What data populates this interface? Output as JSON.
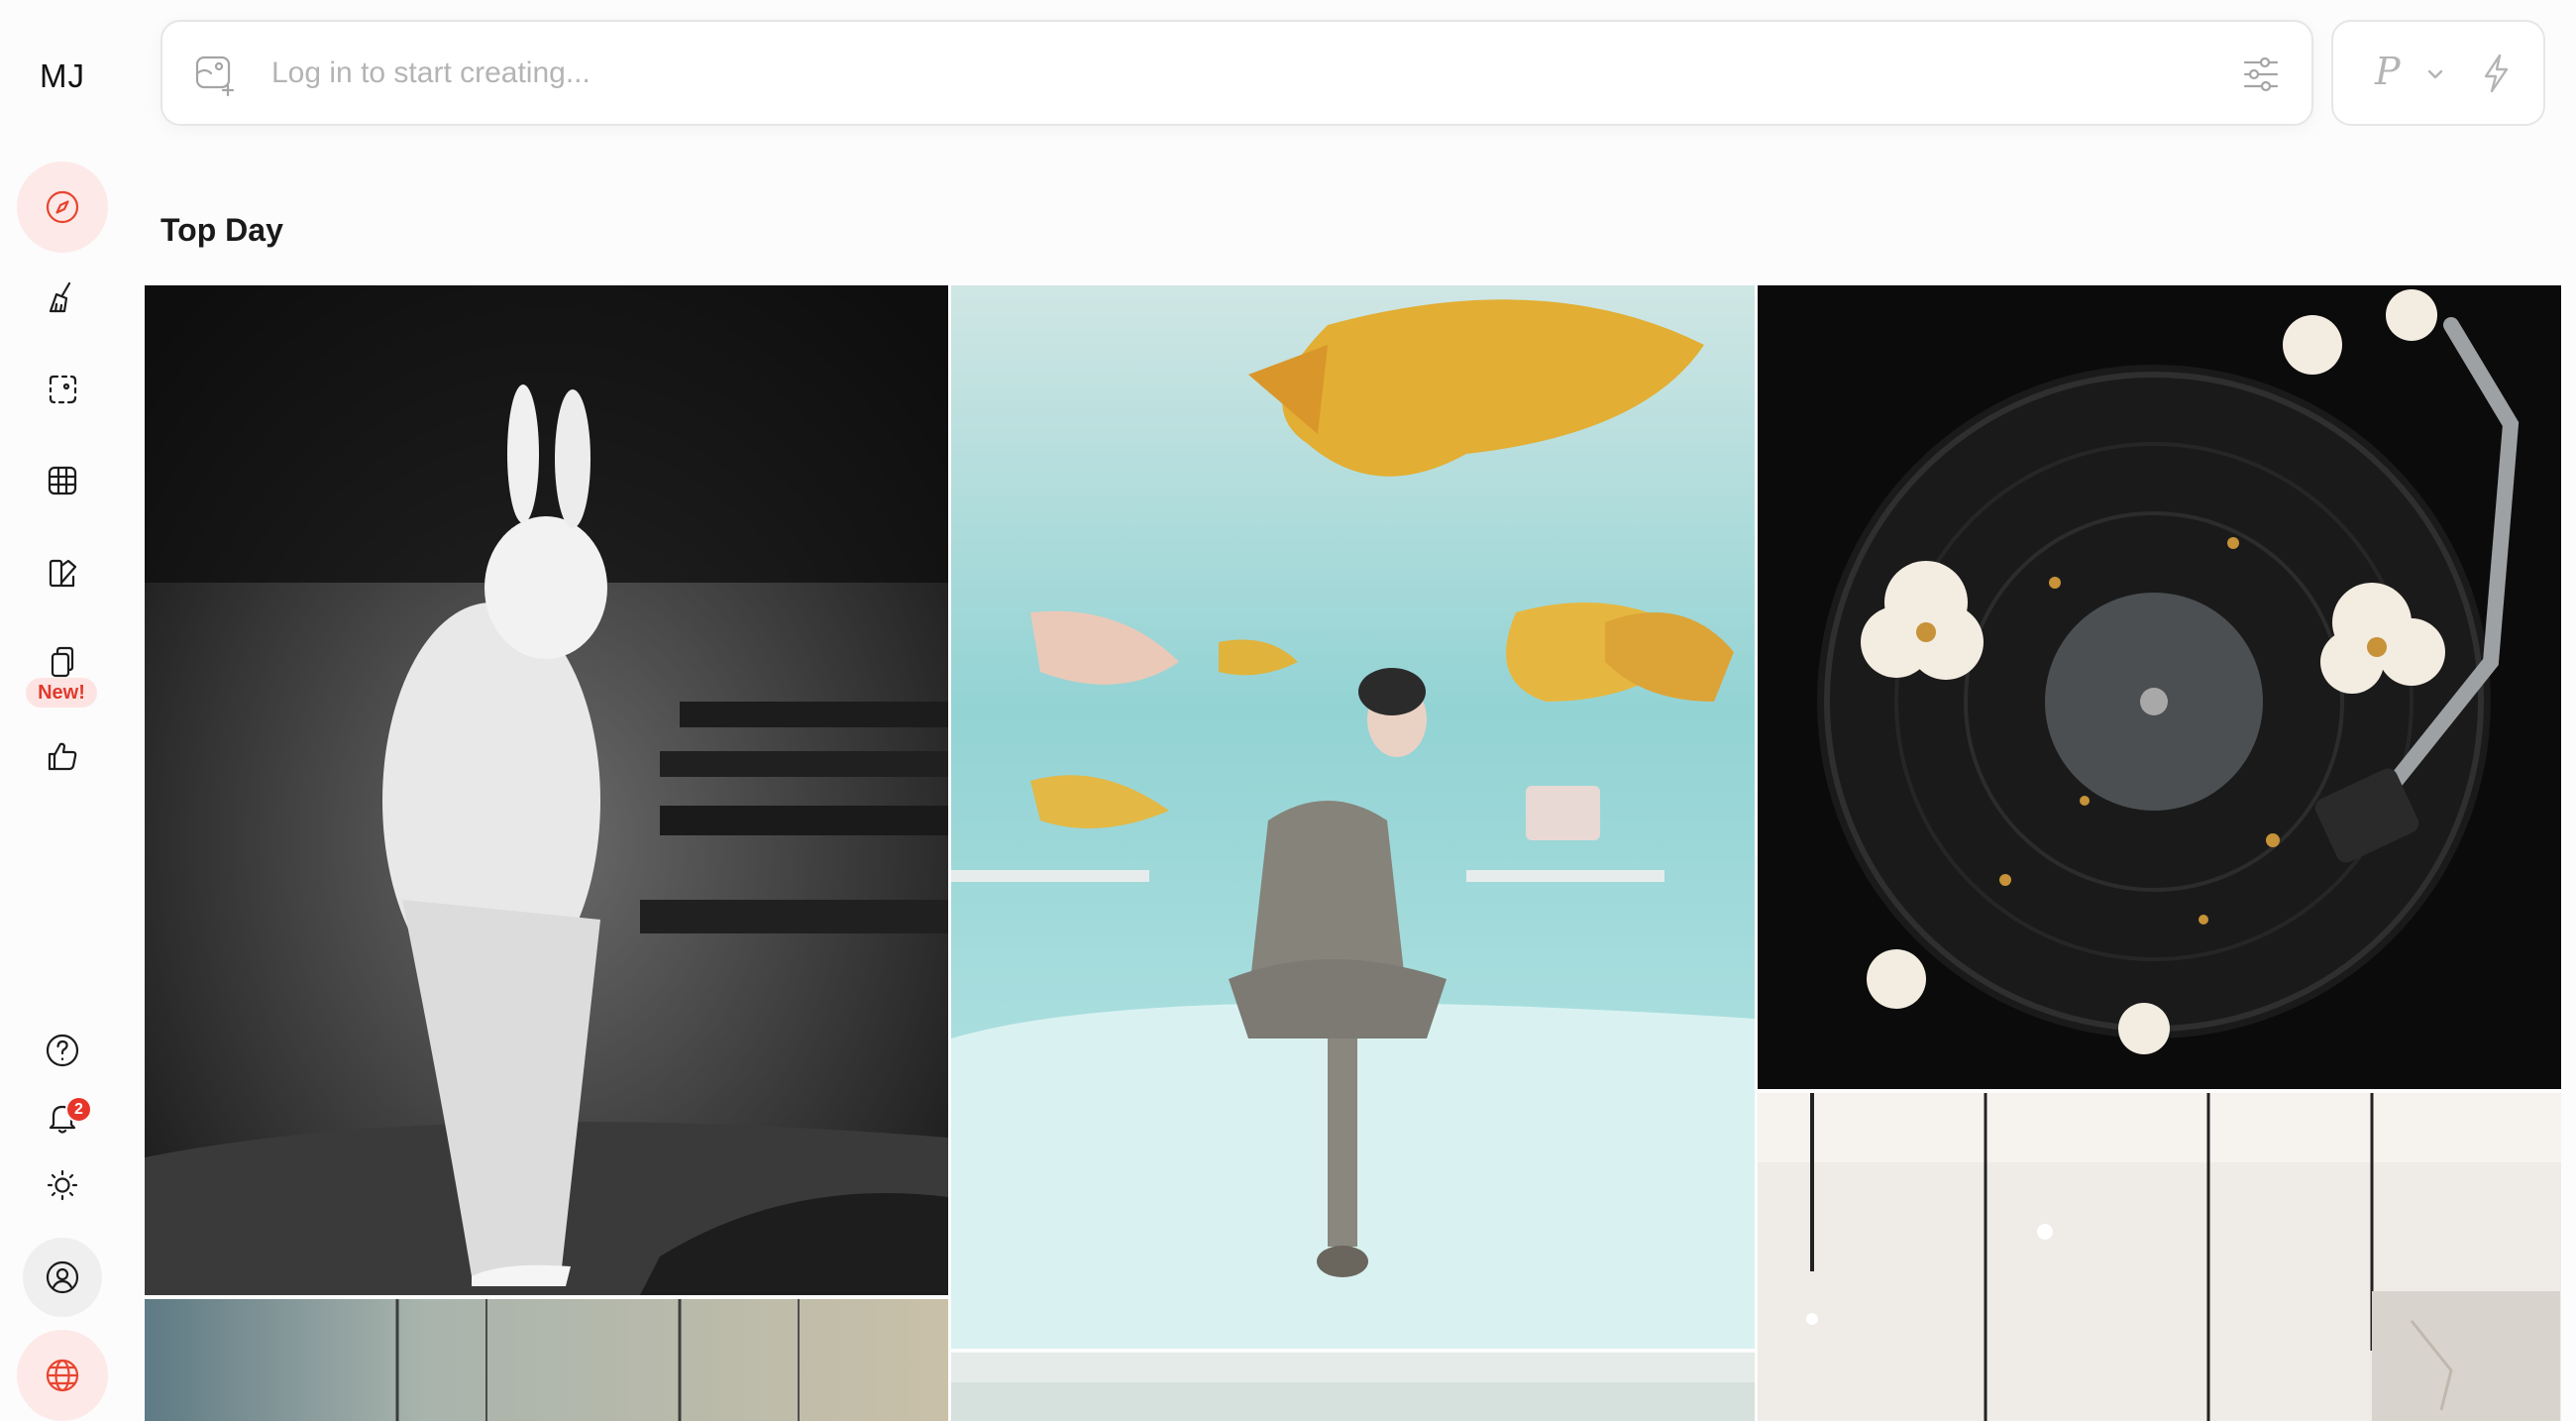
{
  "sidebar": {
    "logo": "MJ",
    "items": [
      {
        "name": "explore",
        "icon": "compass-icon",
        "active": true
      },
      {
        "name": "create",
        "icon": "paintbrush-icon"
      },
      {
        "name": "edit",
        "icon": "selection-icon"
      },
      {
        "name": "organize",
        "icon": "grid-icon"
      },
      {
        "name": "personalize",
        "icon": "swatches-icon"
      },
      {
        "name": "moodboards",
        "icon": "stack-icon",
        "badge": "New!"
      },
      {
        "name": "rate",
        "icon": "thumbs-up-icon"
      }
    ],
    "bottom": [
      {
        "name": "help",
        "icon": "question-icon"
      },
      {
        "name": "notifications",
        "icon": "bell-icon",
        "count": "2"
      },
      {
        "name": "theme",
        "icon": "sun-icon"
      },
      {
        "name": "account",
        "icon": "user-circle-icon"
      },
      {
        "name": "language",
        "icon": "globe-icon"
      }
    ]
  },
  "prompt": {
    "placeholder": "Log in to start creating...",
    "value": ""
  },
  "mode": {
    "label": "P"
  },
  "feed": {
    "section_title": "Top Day"
  },
  "colors": {
    "accent": "#e8452f",
    "accent_bg": "#fde9e8"
  }
}
